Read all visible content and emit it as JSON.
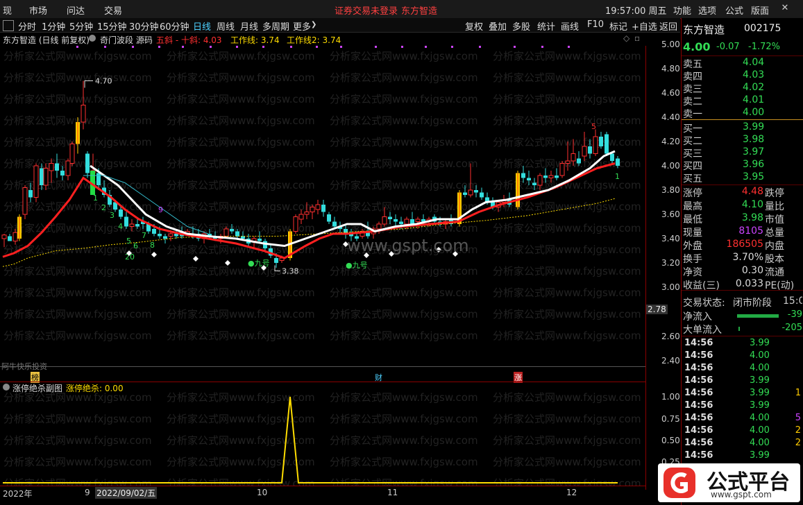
{
  "topbar": {
    "menus": [
      "现",
      "市场",
      "问达",
      "交易"
    ],
    "warning": "证券交易未登录",
    "stock_name": "东方智造",
    "clock": "19:57:00 周五",
    "right_menus": [
      "功能",
      "选项",
      "公式",
      "版面"
    ]
  },
  "periods": [
    "分时",
    "1分钟",
    "5分钟",
    "15分钟",
    "30分钟",
    "60分钟",
    "日线",
    "周线",
    "月线",
    "多周期",
    "更多"
  ],
  "active_period": "日线",
  "toolbar": [
    "复权",
    "叠加",
    "多股",
    "统计",
    "画线",
    "F10",
    "标记",
    "+自选",
    "返回"
  ],
  "title": {
    "stock": "东方智造 (日线 前复权)",
    "formula": "奇门波段 源码",
    "w1": "五斜 - 十斜: 4.03",
    "w2": "工作线: 3.74",
    "w3": "工作线2: 3.74"
  },
  "main_annotations": {
    "high": "4.70",
    "low": "3.38",
    "nine1": "九号",
    "nine2": "九号",
    "seq": [
      "1",
      "2",
      "3",
      "4",
      "5",
      "6",
      "7",
      "8",
      "9",
      "20",
      "5",
      "1"
    ],
    "watermark": "www.gspt.com",
    "bottom_label": "阿牛快乐投资",
    "markers": [
      "榜",
      "财",
      "涨"
    ],
    "axis_price": "2.78"
  },
  "y_labels": [
    "5.00",
    "4.80",
    "4.60",
    "4.40",
    "4.20",
    "4.00",
    "3.80",
    "3.60",
    "3.40",
    "3.20",
    "3.00",
    "2.60",
    "2.40"
  ],
  "sub": {
    "title": "涨停绝杀副图",
    "value": "涨停绝杀: 0.00",
    "y_labels": [
      "1.00",
      "0.75",
      "0.50",
      "0.25"
    ]
  },
  "xaxis": {
    "labels": [
      "2022年",
      "9",
      "2022/09/02/五",
      "10",
      "11",
      "12"
    ]
  },
  "sidebar": {
    "name": "东方智造",
    "code": "002175",
    "price": "4.00",
    "change": "-0.07",
    "pct": "-1.72%",
    "asks": [
      [
        "卖五",
        "4.04"
      ],
      [
        "卖四",
        "4.03"
      ],
      [
        "卖三",
        "4.02"
      ],
      [
        "卖二",
        "4.01"
      ],
      [
        "卖一",
        "4.00"
      ]
    ],
    "bids": [
      [
        "买一",
        "3.99"
      ],
      [
        "买二",
        "3.98"
      ],
      [
        "买三",
        "3.97"
      ],
      [
        "买四",
        "3.96"
      ],
      [
        "买五",
        "3.95"
      ]
    ],
    "stats": [
      [
        "涨停",
        "4.48",
        "跌停"
      ],
      [
        "最高",
        "4.10",
        "量比"
      ],
      [
        "最低",
        "3.98",
        "市值"
      ],
      [
        "现量",
        "8105",
        "总量"
      ],
      [
        "外盘",
        "186505",
        "内盘"
      ],
      [
        "换手",
        "3.70%",
        "股本"
      ],
      [
        "净资",
        "0.30",
        "流通"
      ],
      [
        "收益(三)",
        "0.033",
        "PE(动)"
      ]
    ],
    "trade_state_label": "交易状态:",
    "trade_state": "闭市阶段",
    "trade_time": "15:0",
    "net_in_label": "净流入",
    "net_in": "-39",
    "big_in_label": "大单流入",
    "big_in": "-205",
    "ticks": [
      [
        "14:56",
        "3.99",
        ""
      ],
      [
        "14:56",
        "4.00",
        ""
      ],
      [
        "14:56",
        "4.00",
        ""
      ],
      [
        "14:56",
        "3.99",
        ""
      ],
      [
        "14:56",
        "3.99",
        "1"
      ],
      [
        "14:56",
        "3.99",
        ""
      ],
      [
        "14:56",
        "4.00",
        "5"
      ],
      [
        "14:56",
        "4.00",
        "2"
      ],
      [
        "14:56",
        "4.00",
        "2"
      ],
      [
        "14:56",
        "3.99",
        ""
      ]
    ]
  },
  "logo": {
    "text": "公式平台",
    "url": "www.gspt.com"
  },
  "colors": {
    "up": "#ff3030",
    "down": "#33dddd",
    "ma_white": "#ffffff",
    "ma_red": "#ff2020",
    "ma_yellow": "#ffdd00",
    "green": "#33dd55"
  }
}
